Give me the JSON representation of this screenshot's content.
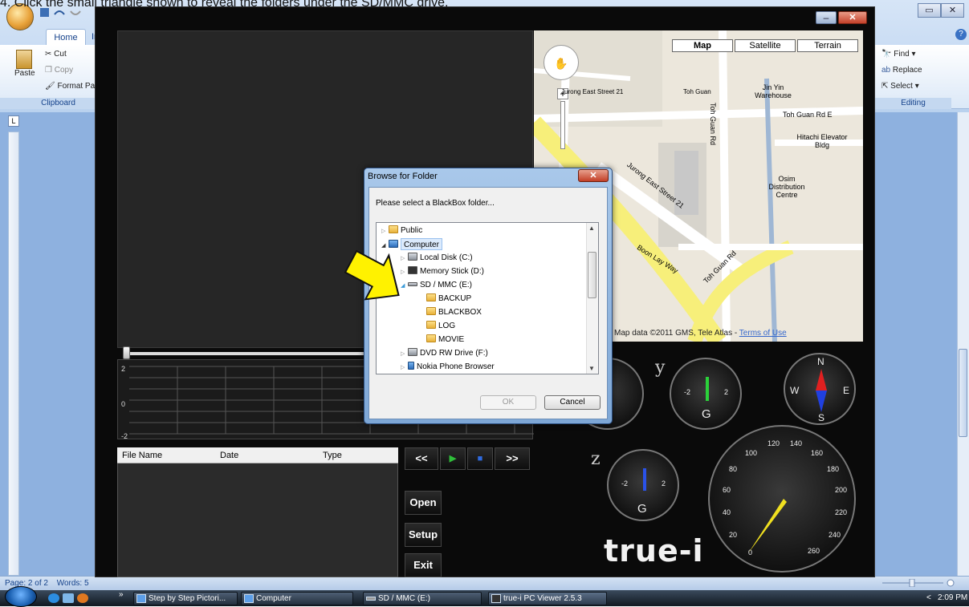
{
  "caption": "4. Click the small triangle shown to reveal the folders under the SD/MMC drive.",
  "word": {
    "home_tab": "Home",
    "insert_tab": "In",
    "cut": "Cut",
    "copy": "Copy",
    "paste": "Paste",
    "format_painter": "Format Pai",
    "clipboard_group": "Clipboard",
    "find": "Find ▾",
    "replace": "Replace",
    "select": "Select ▾",
    "editing_group": "Editing",
    "status_page": "Page: 2 of 2",
    "status_words": "Words: 5"
  },
  "viewer": {
    "map": {
      "btn_map": "Map",
      "btn_satellite": "Satellite",
      "btn_terrain": "Terrain",
      "labels": [
        "Jurong East Street 21",
        "Toh Guan",
        "Jin Yin Warehouse",
        "Toh Guan Rd",
        "Toh Guan Rd E",
        "Hitachi Elevator Bldg",
        "Osim Distribution Centre",
        "Boon Lay Way",
        "Jurong East Street 21",
        "Toh Guan Rd"
      ],
      "attribution": "Map data ©2011 GMS, Tele Atlas - ",
      "terms": "Terms of Use"
    },
    "graph_labels": {
      "top": "2",
      "mid": "0",
      "bottom": "-2"
    },
    "file_columns": {
      "name": "File Name",
      "date": "Date",
      "type": "Type"
    },
    "transport": {
      "rewind": "<<",
      "play": "▶",
      "stop": "■",
      "forward": ">>"
    },
    "buttons": {
      "open": "Open",
      "setup": "Setup",
      "exit": "Exit"
    },
    "logo": "true-i",
    "gauges": {
      "y_label": "y",
      "z_label": "z",
      "g_unit": "G",
      "neg": "-2",
      "pos": "2",
      "compass": {
        "n": "N",
        "s": "S",
        "e": "E",
        "w": "W"
      },
      "speed_ticks": [
        "0",
        "20",
        "40",
        "60",
        "80",
        "100",
        "120",
        "140",
        "160",
        "180",
        "200",
        "220",
        "240",
        "260"
      ]
    }
  },
  "dialog": {
    "title": "Browse for Folder",
    "prompt": "Please select a BlackBox folder...",
    "tree": [
      {
        "label": "Public",
        "icon": "folder",
        "level": 0
      },
      {
        "label": "Computer",
        "icon": "computer",
        "level": 0
      },
      {
        "label": "Local Disk (C:)",
        "icon": "drive",
        "level": 1
      },
      {
        "label": "Memory Stick (D:)",
        "icon": "drive",
        "level": 1
      },
      {
        "label": "SD / MMC (E:)",
        "icon": "drive",
        "level": 1
      },
      {
        "label": "BACKUP",
        "icon": "folder",
        "level": 2
      },
      {
        "label": "BLACKBOX",
        "icon": "folder",
        "level": 2
      },
      {
        "label": "LOG",
        "icon": "folder",
        "level": 2
      },
      {
        "label": "MOVIE",
        "icon": "folder",
        "level": 2
      },
      {
        "label": "DVD RW Drive (F:)",
        "icon": "drive",
        "level": 1
      },
      {
        "label": "Nokia Phone Browser",
        "icon": "phone",
        "level": 1
      }
    ],
    "ok": "OK",
    "cancel": "Cancel"
  },
  "taskbar": {
    "items": [
      "Step by Step Pictori...",
      "Computer",
      "SD / MMC (E:)",
      "true-i PC Viewer 2.5.3"
    ],
    "time": "2:09 PM"
  }
}
